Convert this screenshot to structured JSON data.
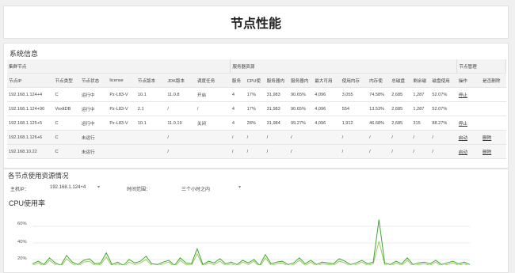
{
  "page_title": "节点性能",
  "system_info": {
    "title": "系统信息",
    "group_headers": [
      "集群节点",
      "服务器资源",
      "节点管理"
    ],
    "columns": [
      "节点IP",
      "节点类型",
      "节点状态",
      "license",
      "节点版本",
      "JDK版本",
      "调度任务",
      "服务",
      "CPU使",
      "服务器内",
      "服务器内",
      "最大可用",
      "使用内存",
      "内存使",
      "总磁盘",
      "剩余磁",
      "磁盘使用",
      "操作",
      "是否删除"
    ],
    "rows": [
      [
        "192.168.1.124+4",
        "C",
        "运行中",
        "Pz-L83-V",
        "10.1",
        "11.0.8",
        "开启",
        "4",
        "17%",
        "31,983",
        "90.65%",
        "4,096",
        "3,055",
        "74.58%",
        "2,685",
        "1,287",
        "52.07%",
        "停止",
        ""
      ],
      [
        "192.168.1.124+90",
        "VoxltDB",
        "运行中",
        "Pz-L83-V",
        "2.1",
        "/",
        "/",
        "4",
        "17%",
        "31,983",
        "90.65%",
        "4,096",
        "554",
        "13.53%",
        "2,685",
        "1,287",
        "52.07%",
        "",
        ""
      ],
      [
        "192.168.1.125+5",
        "C",
        "运行中",
        "Pz-L83-V",
        "10.1",
        "11.0.19",
        "关闭",
        "4",
        "28%",
        "31,984",
        "99.27%",
        "4,096",
        "1,912",
        "46.68%",
        "2,685",
        "315",
        "88.27%",
        "停止",
        ""
      ],
      [
        "192.168.1.126+6",
        "C",
        "未运行",
        "",
        "",
        "/",
        "",
        "/",
        "/",
        "/",
        "/",
        "",
        "/",
        "/",
        "/",
        "/",
        "/",
        "启动",
        "删除"
      ],
      [
        "192.168.10.22",
        "C",
        "未运行",
        "",
        "",
        "/",
        "",
        "/",
        "/",
        "/",
        "/",
        "",
        "/",
        "/",
        "/",
        "/",
        "/",
        "启动",
        "删除"
      ]
    ]
  },
  "usage": {
    "title": "各节点使用资源情况",
    "host_label": "主机IP：",
    "host_value": "192.168.1.124+4",
    "range_label": "时间范围：",
    "range_value": "三个小时之内",
    "caret": "▾",
    "cpu_title": "CPU使用率",
    "yticks": [
      "60%",
      "40%",
      "20%"
    ]
  },
  "chart_data": {
    "type": "line",
    "title": "CPU使用率",
    "ylim": [
      0,
      70
    ],
    "yticks": [
      "60%",
      "40%",
      "20%"
    ],
    "series": [
      {
        "color": "#3fa535",
        "values": [
          15,
          18,
          14,
          22,
          16,
          13,
          25,
          17,
          14,
          19,
          21,
          15,
          16,
          28,
          14,
          17,
          13,
          20,
          16,
          18,
          24,
          15,
          14,
          17,
          19,
          13,
          22,
          16,
          15,
          33,
          14,
          18,
          16,
          21,
          15,
          17,
          14,
          19,
          16,
          20,
          13,
          26,
          15,
          17,
          18,
          14,
          16,
          22,
          15,
          19,
          14,
          17,
          16,
          15,
          21,
          18,
          14,
          16,
          19,
          15,
          17,
          68,
          16,
          14,
          18,
          15,
          22,
          14,
          16,
          17,
          15,
          19,
          14,
          16,
          18,
          15,
          17,
          14
        ]
      },
      {
        "color": "#9acd5a",
        "values": [
          13,
          16,
          12,
          19,
          14,
          11,
          21,
          15,
          12,
          17,
          18,
          13,
          14,
          23,
          12,
          15,
          11,
          17,
          14,
          16,
          20,
          13,
          12,
          15,
          17,
          11,
          19,
          14,
          13,
          27,
          12,
          16,
          14,
          18,
          13,
          15,
          12,
          17,
          14,
          18,
          11,
          22,
          13,
          15,
          16,
          12,
          14,
          19,
          13,
          17,
          12,
          15,
          14,
          13,
          18,
          16,
          12,
          14,
          17,
          13,
          15,
          42,
          14,
          12,
          16,
          13,
          19,
          12,
          14,
          15,
          13,
          17,
          12,
          14,
          16,
          13,
          15,
          12
        ]
      }
    ]
  }
}
